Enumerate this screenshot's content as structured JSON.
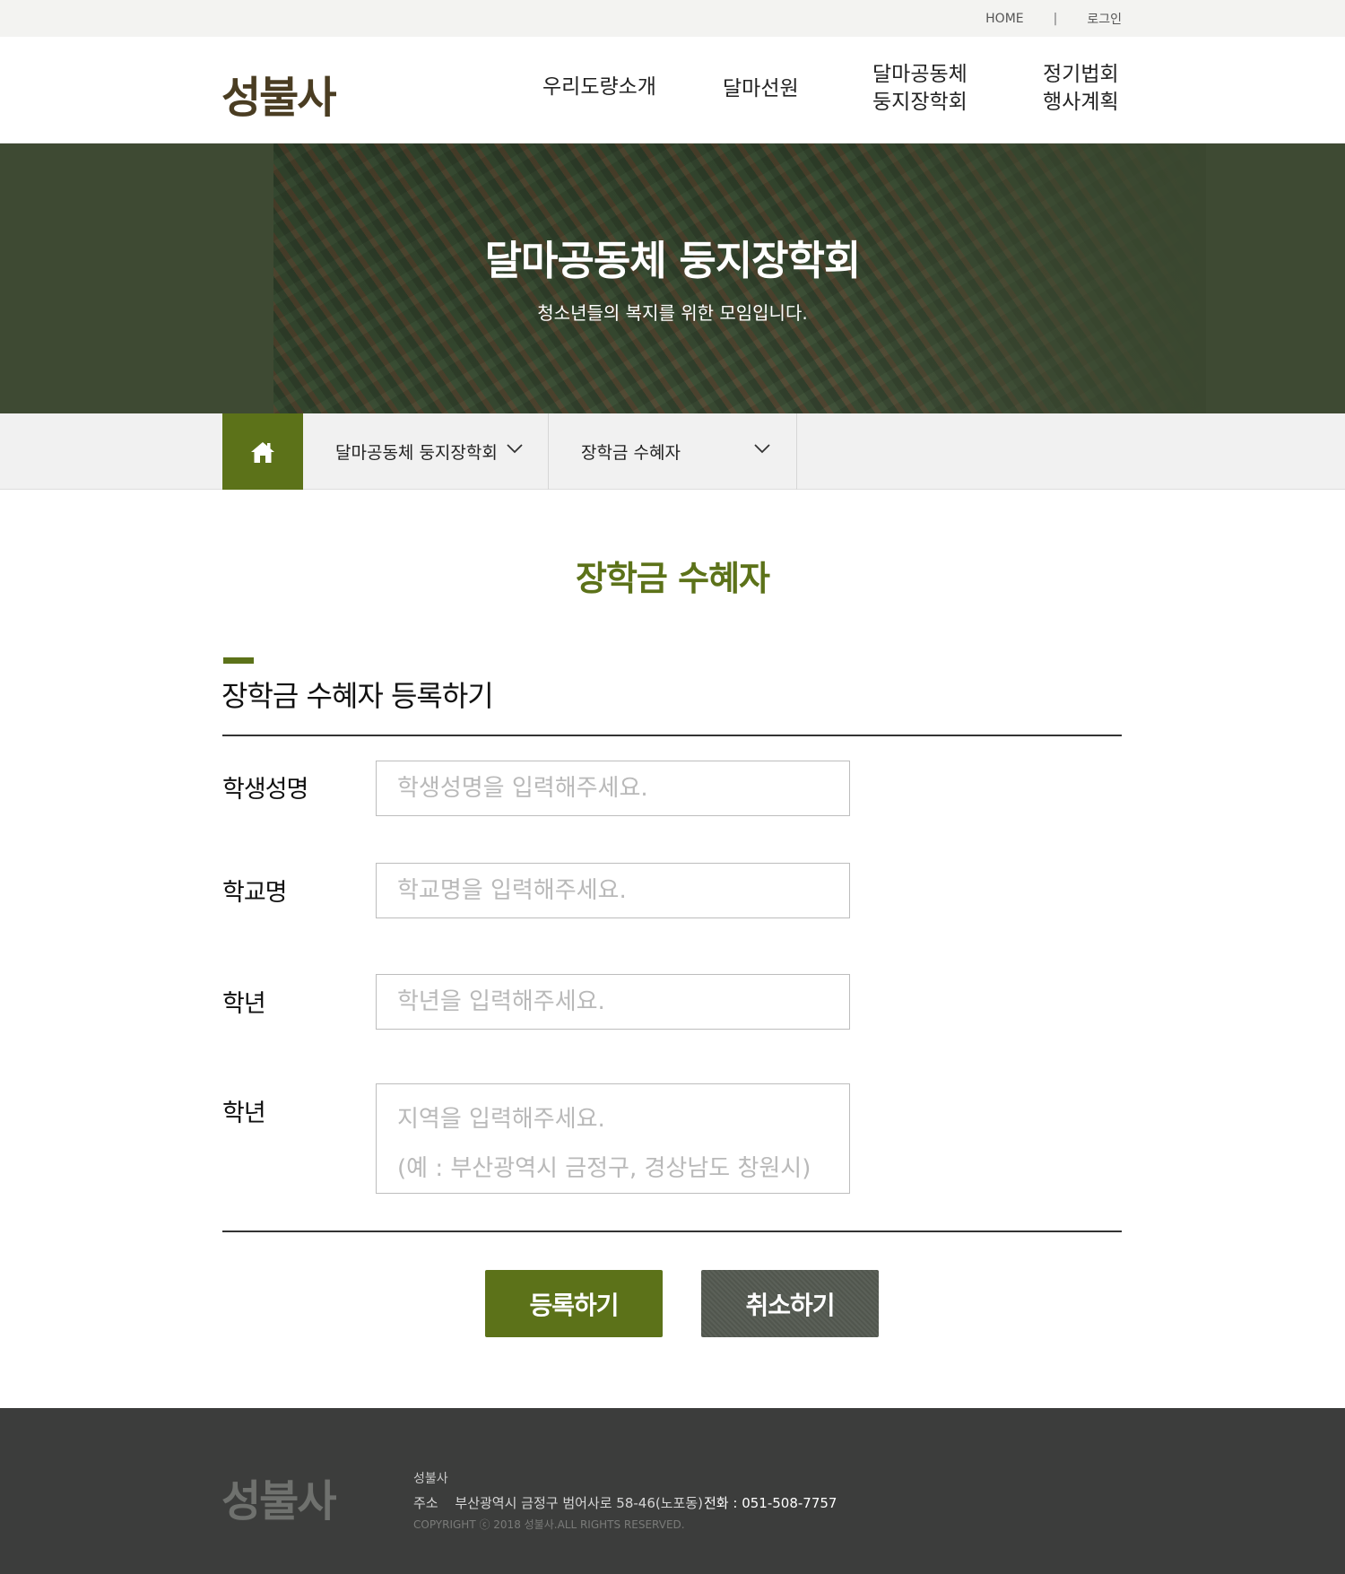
{
  "util": {
    "home": "HOME",
    "separator": "|",
    "login": "로그인"
  },
  "header": {
    "logo": "성불사",
    "nav": [
      {
        "lines": [
          "우리도량소개"
        ]
      },
      {
        "lines": [
          "달마선원"
        ]
      },
      {
        "lines": [
          "달마공동체",
          "둥지장학회"
        ]
      },
      {
        "lines": [
          "정기법회",
          "행사계획"
        ]
      }
    ]
  },
  "hero": {
    "title": "달마공동체 둥지장학회",
    "subtitle": "청소년들의 복지를 위한 모임입니다."
  },
  "breadcrumb": {
    "home_icon": "home-icon",
    "level1": "달마공동체 둥지장학회",
    "level2": "장학금 수혜자"
  },
  "page": {
    "title": "장학금 수혜자"
  },
  "form": {
    "section_title": "장학금 수혜자 등록하기",
    "fields": [
      {
        "label": "학생성명",
        "placeholder": "학생성명을 입력해주세요."
      },
      {
        "label": "학교명",
        "placeholder": "학교명을 입력해주세요."
      },
      {
        "label": "학년",
        "placeholder": "학년을 입력해주세요."
      },
      {
        "label": "학년",
        "placeholder": "지역을 입력해주세요.\n(예 : 부산광역시 금정구, 경상남도 창원시)"
      }
    ],
    "submit_label": "등록하기",
    "cancel_label": "취소하기"
  },
  "footer": {
    "logo": "성불사",
    "name": "성불사",
    "address_label": "주소",
    "address": "부산광역시 금정구 범어사로 58-46(노포동)",
    "tel": "전화 : 051-508-7757",
    "copyright": "COPYRIGHT ⓒ 2018 성불사.ALL RIGHTS RESERVED."
  },
  "colors": {
    "accent": "#5c7219",
    "logo_brown": "#4a3d22",
    "footer_bg": "#3c3d3c",
    "hero_bg": "#3e4a33",
    "cancel_bg": "#545a51"
  }
}
